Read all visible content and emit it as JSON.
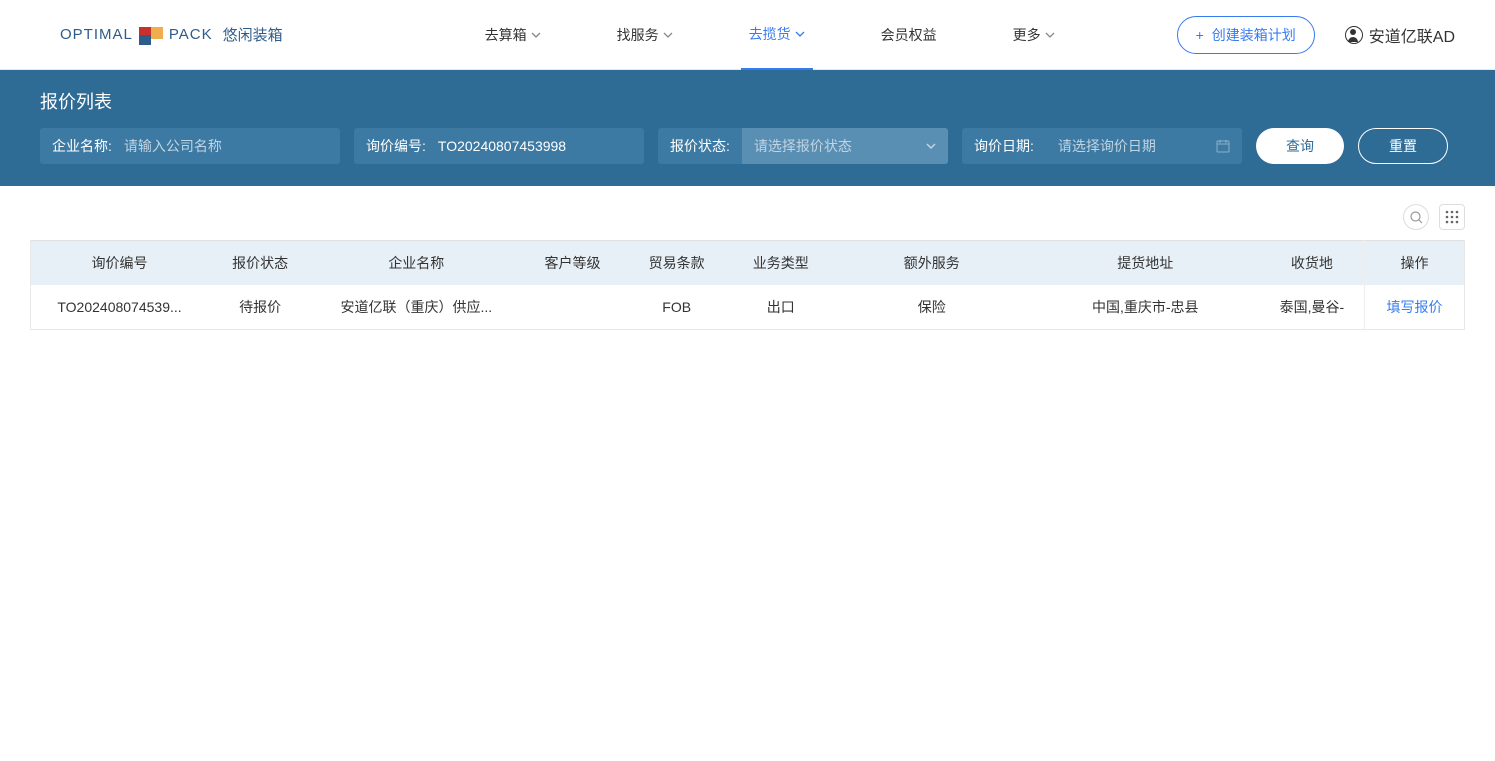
{
  "header": {
    "logo_en": "OPTIMAL",
    "logo_en2": "PACK",
    "logo_cn": "悠闲装箱",
    "nav": [
      {
        "label": "去算箱",
        "has_chevron": true,
        "active": false
      },
      {
        "label": "找服务",
        "has_chevron": true,
        "active": false
      },
      {
        "label": "去揽货",
        "has_chevron": true,
        "active": true
      },
      {
        "label": "会员权益",
        "has_chevron": false,
        "active": false
      },
      {
        "label": "更多",
        "has_chevron": true,
        "active": false
      }
    ],
    "create_button": "创建装箱计划",
    "user_name": "安道亿联AD"
  },
  "filter": {
    "title": "报价列表",
    "company_label": "企业名称:",
    "company_placeholder": "请输入公司名称",
    "inquiry_no_label": "询价编号:",
    "inquiry_no_value": "TO20240807453998",
    "status_label": "报价状态:",
    "status_placeholder": "请选择报价状态",
    "date_label": "询价日期:",
    "date_placeholder": "请选择询价日期",
    "query_btn": "查询",
    "reset_btn": "重置"
  },
  "table": {
    "headers": [
      "询价编号",
      "报价状态",
      "企业名称",
      "客户等级",
      "贸易条款",
      "业务类型",
      "额外服务",
      "提货地址",
      "收货地"
    ],
    "action_header": "操作",
    "rows": [
      {
        "inquiry_no": "TO202408074539...",
        "status": "待报价",
        "company": "安道亿联（重庆）供应...",
        "level": "",
        "terms": "FOB",
        "biz_type": "出口",
        "extra": "保险",
        "pickup": "中国,重庆市-忠县",
        "delivery": "泰国,曼谷-",
        "action": "填写报价"
      }
    ]
  }
}
